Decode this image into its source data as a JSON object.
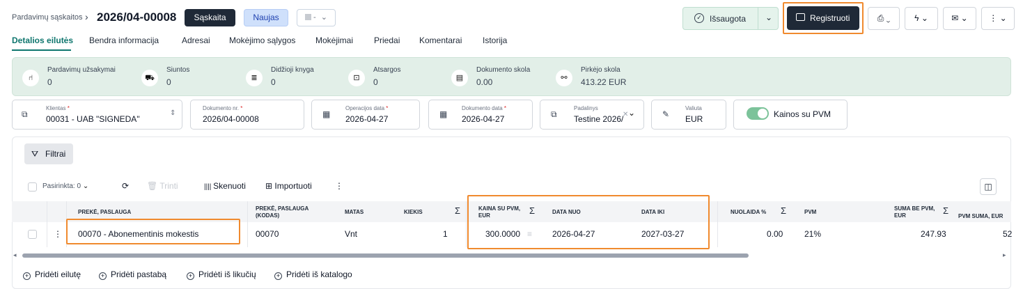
{
  "header": {
    "breadcrumb": "Pardavimų sąskaitos",
    "doc_title": "2026/04-00008",
    "badge_type": "Sąskaita",
    "badge_status": "Naujas",
    "color_select": "-",
    "saved_label": "Išsaugota",
    "register_label": "Registruoti"
  },
  "tabs": [
    "Detalios eilutės",
    "Bendra informacija",
    "Adresai",
    "Mokėjimo sąlygos",
    "Mokėjimai",
    "Priedai",
    "Komentarai",
    "Istorija"
  ],
  "stats": [
    {
      "label": "Pardavimų užsakymai",
      "value": "0",
      "icon": "order-icon"
    },
    {
      "label": "Siuntos",
      "value": "0",
      "icon": "truck-icon"
    },
    {
      "label": "Didžioji knyga",
      "value": "0",
      "icon": "ledger-icon"
    },
    {
      "label": "Atsargos",
      "value": "0",
      "icon": "inbox-icon"
    },
    {
      "label": "Dokumento skola",
      "value": "0.00",
      "icon": "cash-register-icon"
    },
    {
      "label": "Pirkėjo skola",
      "value": "413.22 EUR",
      "icon": "handshake-icon"
    }
  ],
  "fields": {
    "client": {
      "label": "Klientas",
      "value": "00031 - UAB \"SIGNEDA\""
    },
    "doc_nr": {
      "label": "Dokumento nr.",
      "value": "2026/04-00008"
    },
    "op_date": {
      "label": "Operacijos data",
      "value": "2026-04-27"
    },
    "doc_date": {
      "label": "Dokumento data",
      "value": "2026-04-27"
    },
    "division": {
      "label": "Padalinys",
      "value": "Testine 2026/"
    },
    "currency": {
      "label": "Valiuta",
      "value": "EUR"
    },
    "vat_toggle": {
      "label": "Kainos su PVM",
      "on": true
    }
  },
  "toolbar": {
    "filter": "Filtrai",
    "selected": "Pasirinkta: 0",
    "delete": "Trinti",
    "scan": "Skenuoti",
    "import": "Importuoti"
  },
  "table": {
    "headers": {
      "item": "PREKĖ, PASLAUGA",
      "code_1": "PREKĖ, PASLAUGA",
      "code_2": "(KODAS)",
      "unit": "MATAS",
      "qty": "KIEKIS",
      "price_1": "KAINA SU PVM,",
      "price_2": "EUR",
      "date_from": "DATA NUO",
      "date_to": "DATA IKI",
      "discount": "NUOLAIDA %",
      "vat": "PVM",
      "net_1": "SUMA BE PVM,",
      "net_2": "EUR",
      "vat_sum": "PVM SUMA, EUR"
    },
    "rows": [
      {
        "item": "00070 - Abonementinis mokestis",
        "code": "00070",
        "unit": "Vnt",
        "qty": "1",
        "price": "300.0000",
        "date_from": "2026-04-27",
        "date_to": "2027-03-27",
        "discount": "0.00",
        "vat": "21%",
        "net": "247.93",
        "vat_sum": "52"
      }
    ]
  },
  "footer_actions": [
    "Pridėti eilutę",
    "Pridėti pastabą",
    "Pridėti iš likučių",
    "Pridėti iš katalogo"
  ]
}
